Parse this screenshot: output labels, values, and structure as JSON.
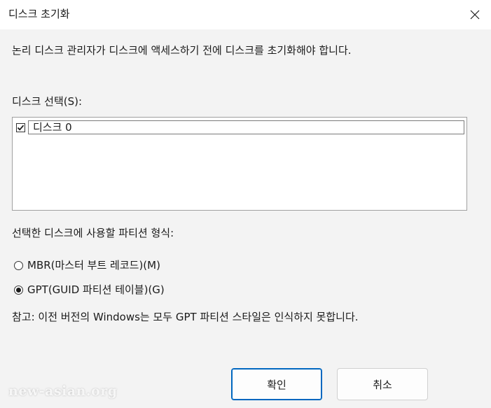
{
  "window": {
    "title": "디스크 초기화"
  },
  "intro_text": "논리 디스크 관리자가 디스크에 액세스하기 전에 디스크를 초기화해야 합니다.",
  "disk_select": {
    "label": "디스크 선택(S):",
    "items": [
      {
        "label": "디스크 0",
        "checked": true
      }
    ]
  },
  "partition_style": {
    "label": "선택한 디스크에 사용할 파티션 형식:",
    "options": [
      {
        "label": "MBR(마스터 부트 레코드)(M)",
        "selected": false
      },
      {
        "label": "GPT(GUID 파티션 테이블)(G)",
        "selected": true
      }
    ]
  },
  "note": "참고: 이전 버전의 Windows는 모두 GPT 파티션 스타일은 인식하지 못합니다.",
  "buttons": {
    "ok": "확인",
    "cancel": "취소"
  },
  "watermark": "new-asian.org",
  "icons": {
    "close": "close-icon",
    "check": "checkmark-icon"
  },
  "colors": {
    "accent": "#0067c0",
    "background": "#f3f3f3",
    "titlebar": "#ffffff"
  }
}
